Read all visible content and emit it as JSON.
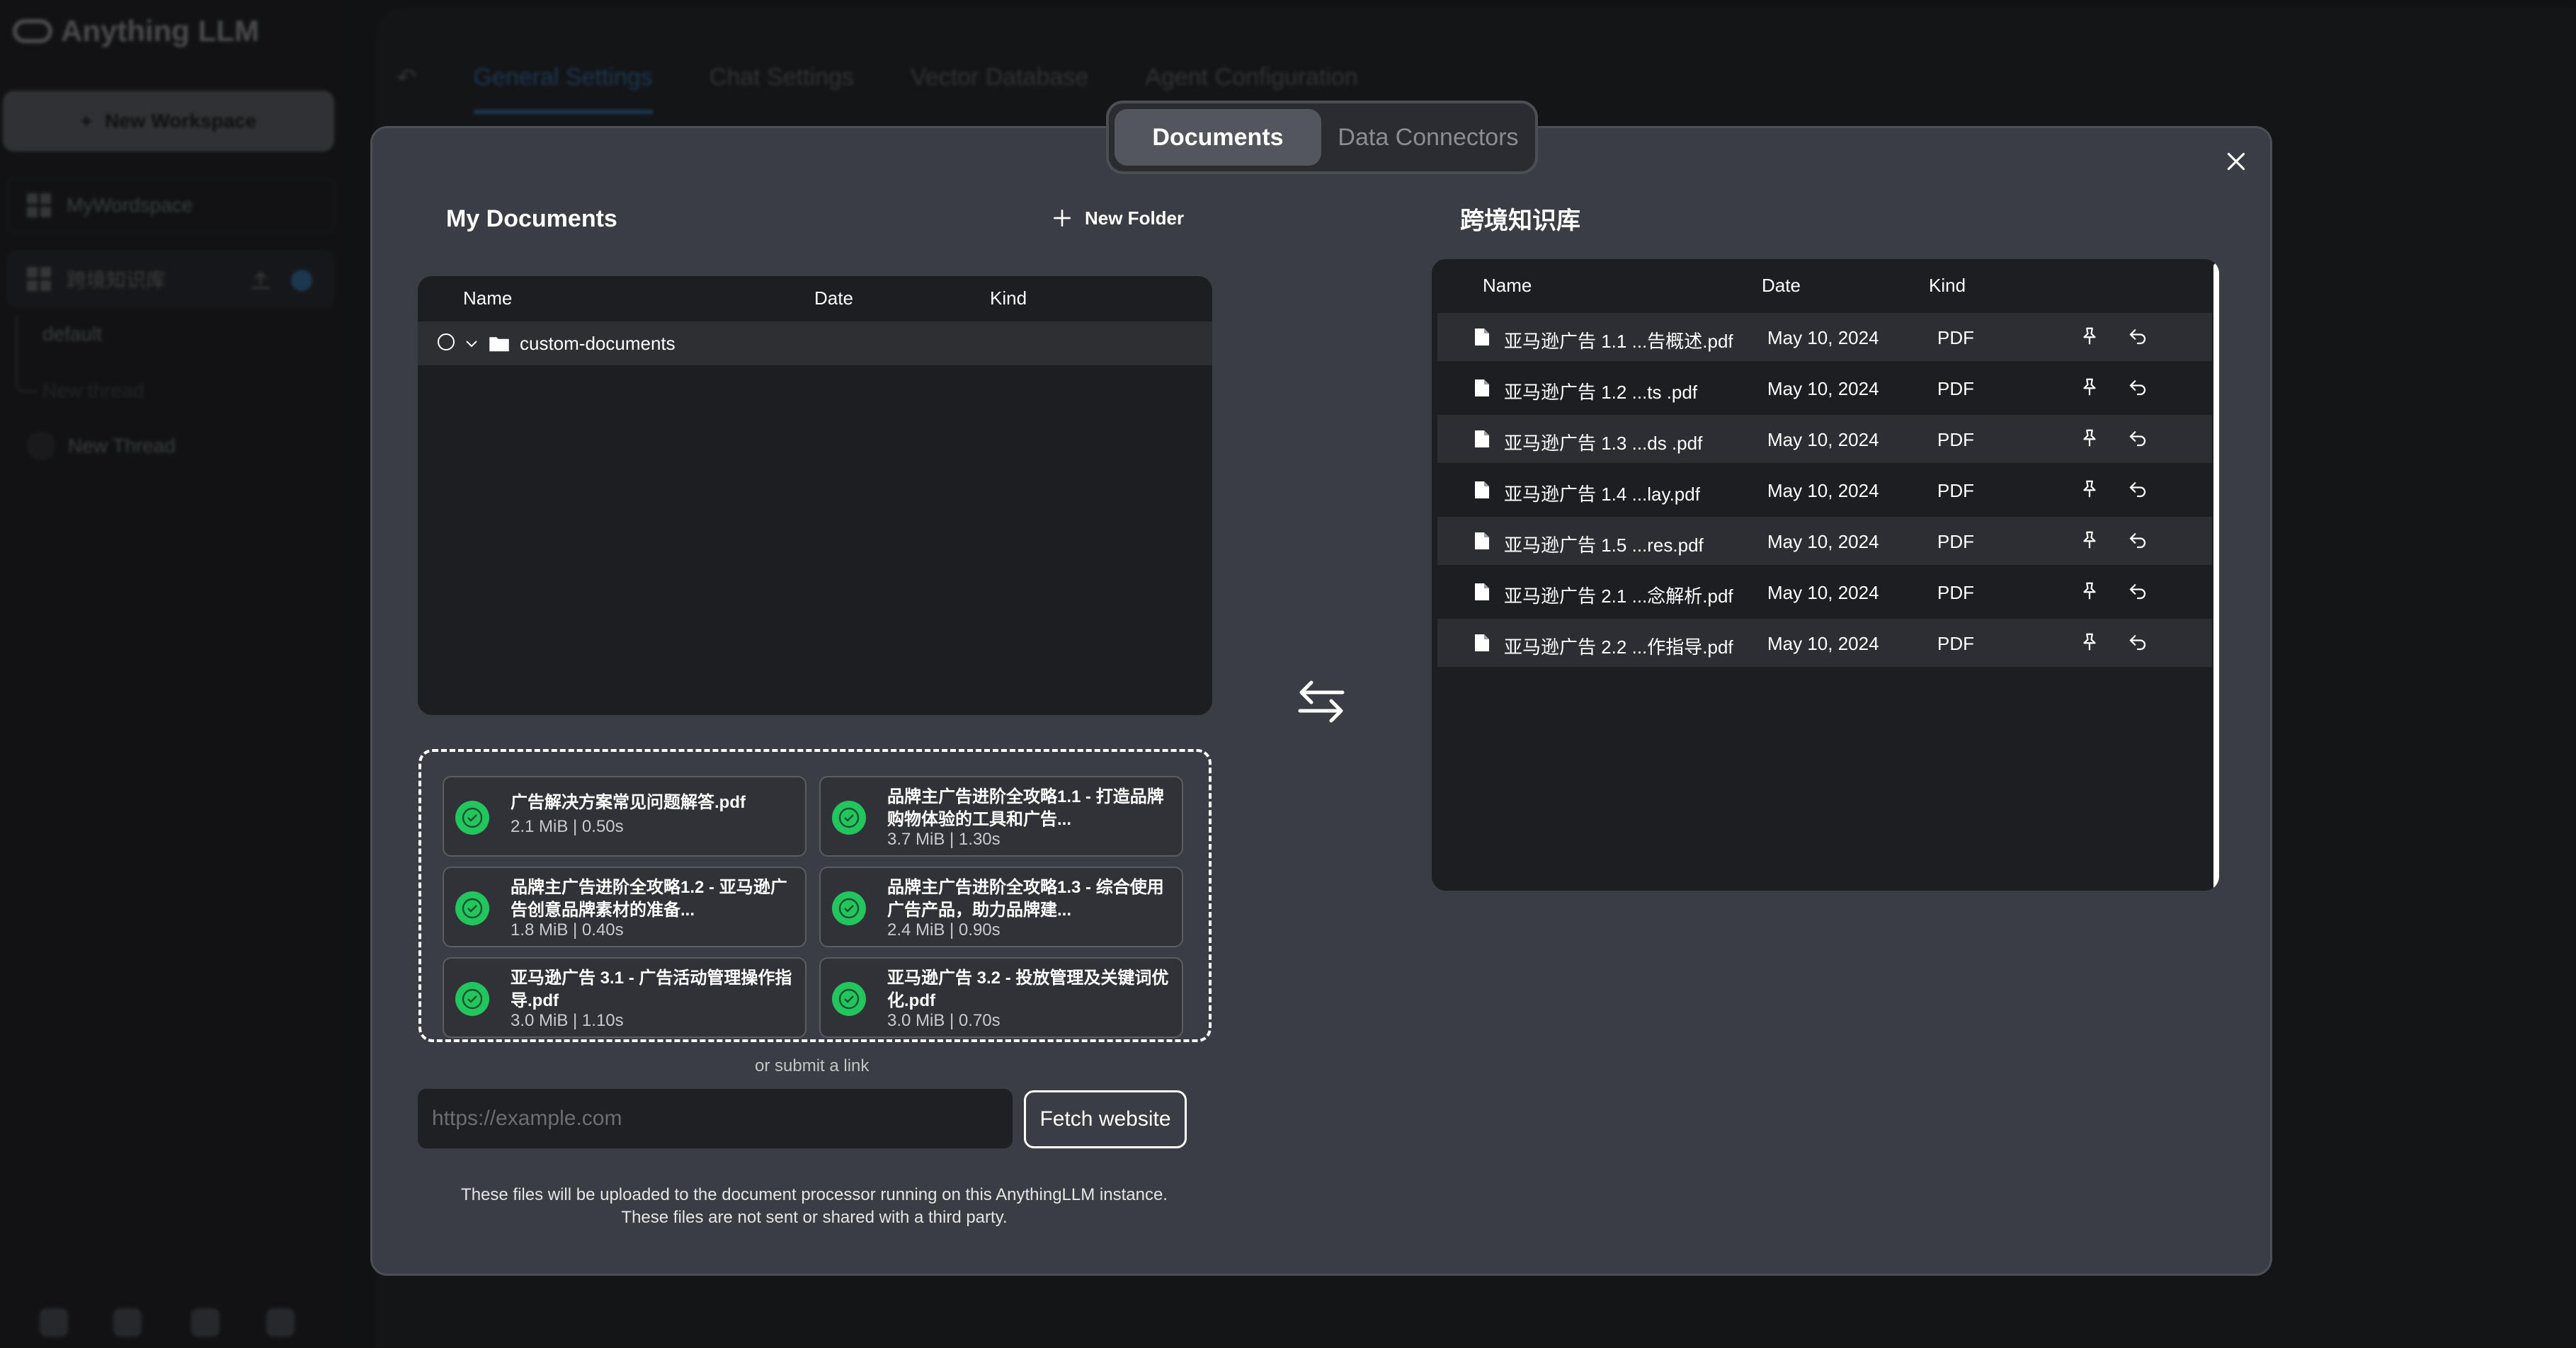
{
  "app": {
    "logo_text": "Anything LLM",
    "new_workspace_label": "New Workspace",
    "workspaces": [
      {
        "label": "MyWordspace"
      },
      {
        "label": "跨境知识库"
      }
    ],
    "threads": [
      {
        "label": "default"
      },
      {
        "label": "New thread"
      }
    ],
    "new_thread_label": "New Thread",
    "settings_tabs": [
      {
        "label": "General Settings"
      },
      {
        "label": "Chat Settings"
      },
      {
        "label": "Vector Database"
      },
      {
        "label": "Agent Configuration"
      }
    ]
  },
  "modal": {
    "tabs": {
      "documents": "Documents",
      "data_connectors": "Data Connectors"
    },
    "my_documents": {
      "title": "My Documents",
      "new_folder_label": "New Folder",
      "columns": {
        "name": "Name",
        "date": "Date",
        "kind": "Kind"
      },
      "folders": [
        {
          "name": "custom-documents"
        }
      ]
    },
    "uploads": [
      {
        "name": "广告解决方案常见问题解答.pdf",
        "meta": "2.1 MiB | 0.50s"
      },
      {
        "name": "品牌主广告进阶全攻略1.1 - 打造品牌购物体验的工具和广告...",
        "meta": "3.7 MiB | 1.30s"
      },
      {
        "name": "品牌主广告进阶全攻略1.2 - 亚马逊广告创意品牌素材的准备...",
        "meta": "1.8 MiB | 0.40s"
      },
      {
        "name": "品牌主广告进阶全攻略1.3 - 综合使用广告产品，助力品牌建...",
        "meta": "2.4 MiB | 0.90s"
      },
      {
        "name": "亚马逊广告 3.1 - 广告活动管理操作指导.pdf",
        "meta": "3.0 MiB | 1.10s"
      },
      {
        "name": "亚马逊广告 3.2 - 投放管理及关键词优化.pdf",
        "meta": "3.0 MiB | 0.70s"
      }
    ],
    "submit_link_label": "or submit a link",
    "url_placeholder": "https://example.com",
    "fetch_button_label": "Fetch website",
    "disclaimer_line1": "These files will be uploaded to the document processor running on this AnythingLLM instance.",
    "disclaimer_line2": "These files are not sent or shared with a third party.",
    "workspace_docs": {
      "title": "跨境知识库",
      "columns": {
        "name": "Name",
        "date": "Date",
        "kind": "Kind"
      },
      "rows": [
        {
          "name": "亚马逊广告 1.1 ...告概述.pdf",
          "date": "May 10, 2024",
          "kind": "PDF"
        },
        {
          "name": "亚马逊广告 1.2 ...ts .pdf",
          "date": "May 10, 2024",
          "kind": "PDF"
        },
        {
          "name": "亚马逊广告 1.3 ...ds .pdf",
          "date": "May 10, 2024",
          "kind": "PDF"
        },
        {
          "name": "亚马逊广告 1.4 ...lay.pdf",
          "date": "May 10, 2024",
          "kind": "PDF"
        },
        {
          "name": "亚马逊广告 1.5 ...res.pdf",
          "date": "May 10, 2024",
          "kind": "PDF"
        },
        {
          "name": "亚马逊广告 2.1 ...念解析.pdf",
          "date": "May 10, 2024",
          "kind": "PDF"
        },
        {
          "name": "亚马逊广告 2.2 ...作指导.pdf",
          "date": "May 10, 2024",
          "kind": "PDF"
        }
      ]
    }
  },
  "colors": {
    "success": "#22c55e",
    "accent_blue": "#46a4ff",
    "modal_bg": "#3a3d44",
    "table_bg": "#1d1e21"
  }
}
